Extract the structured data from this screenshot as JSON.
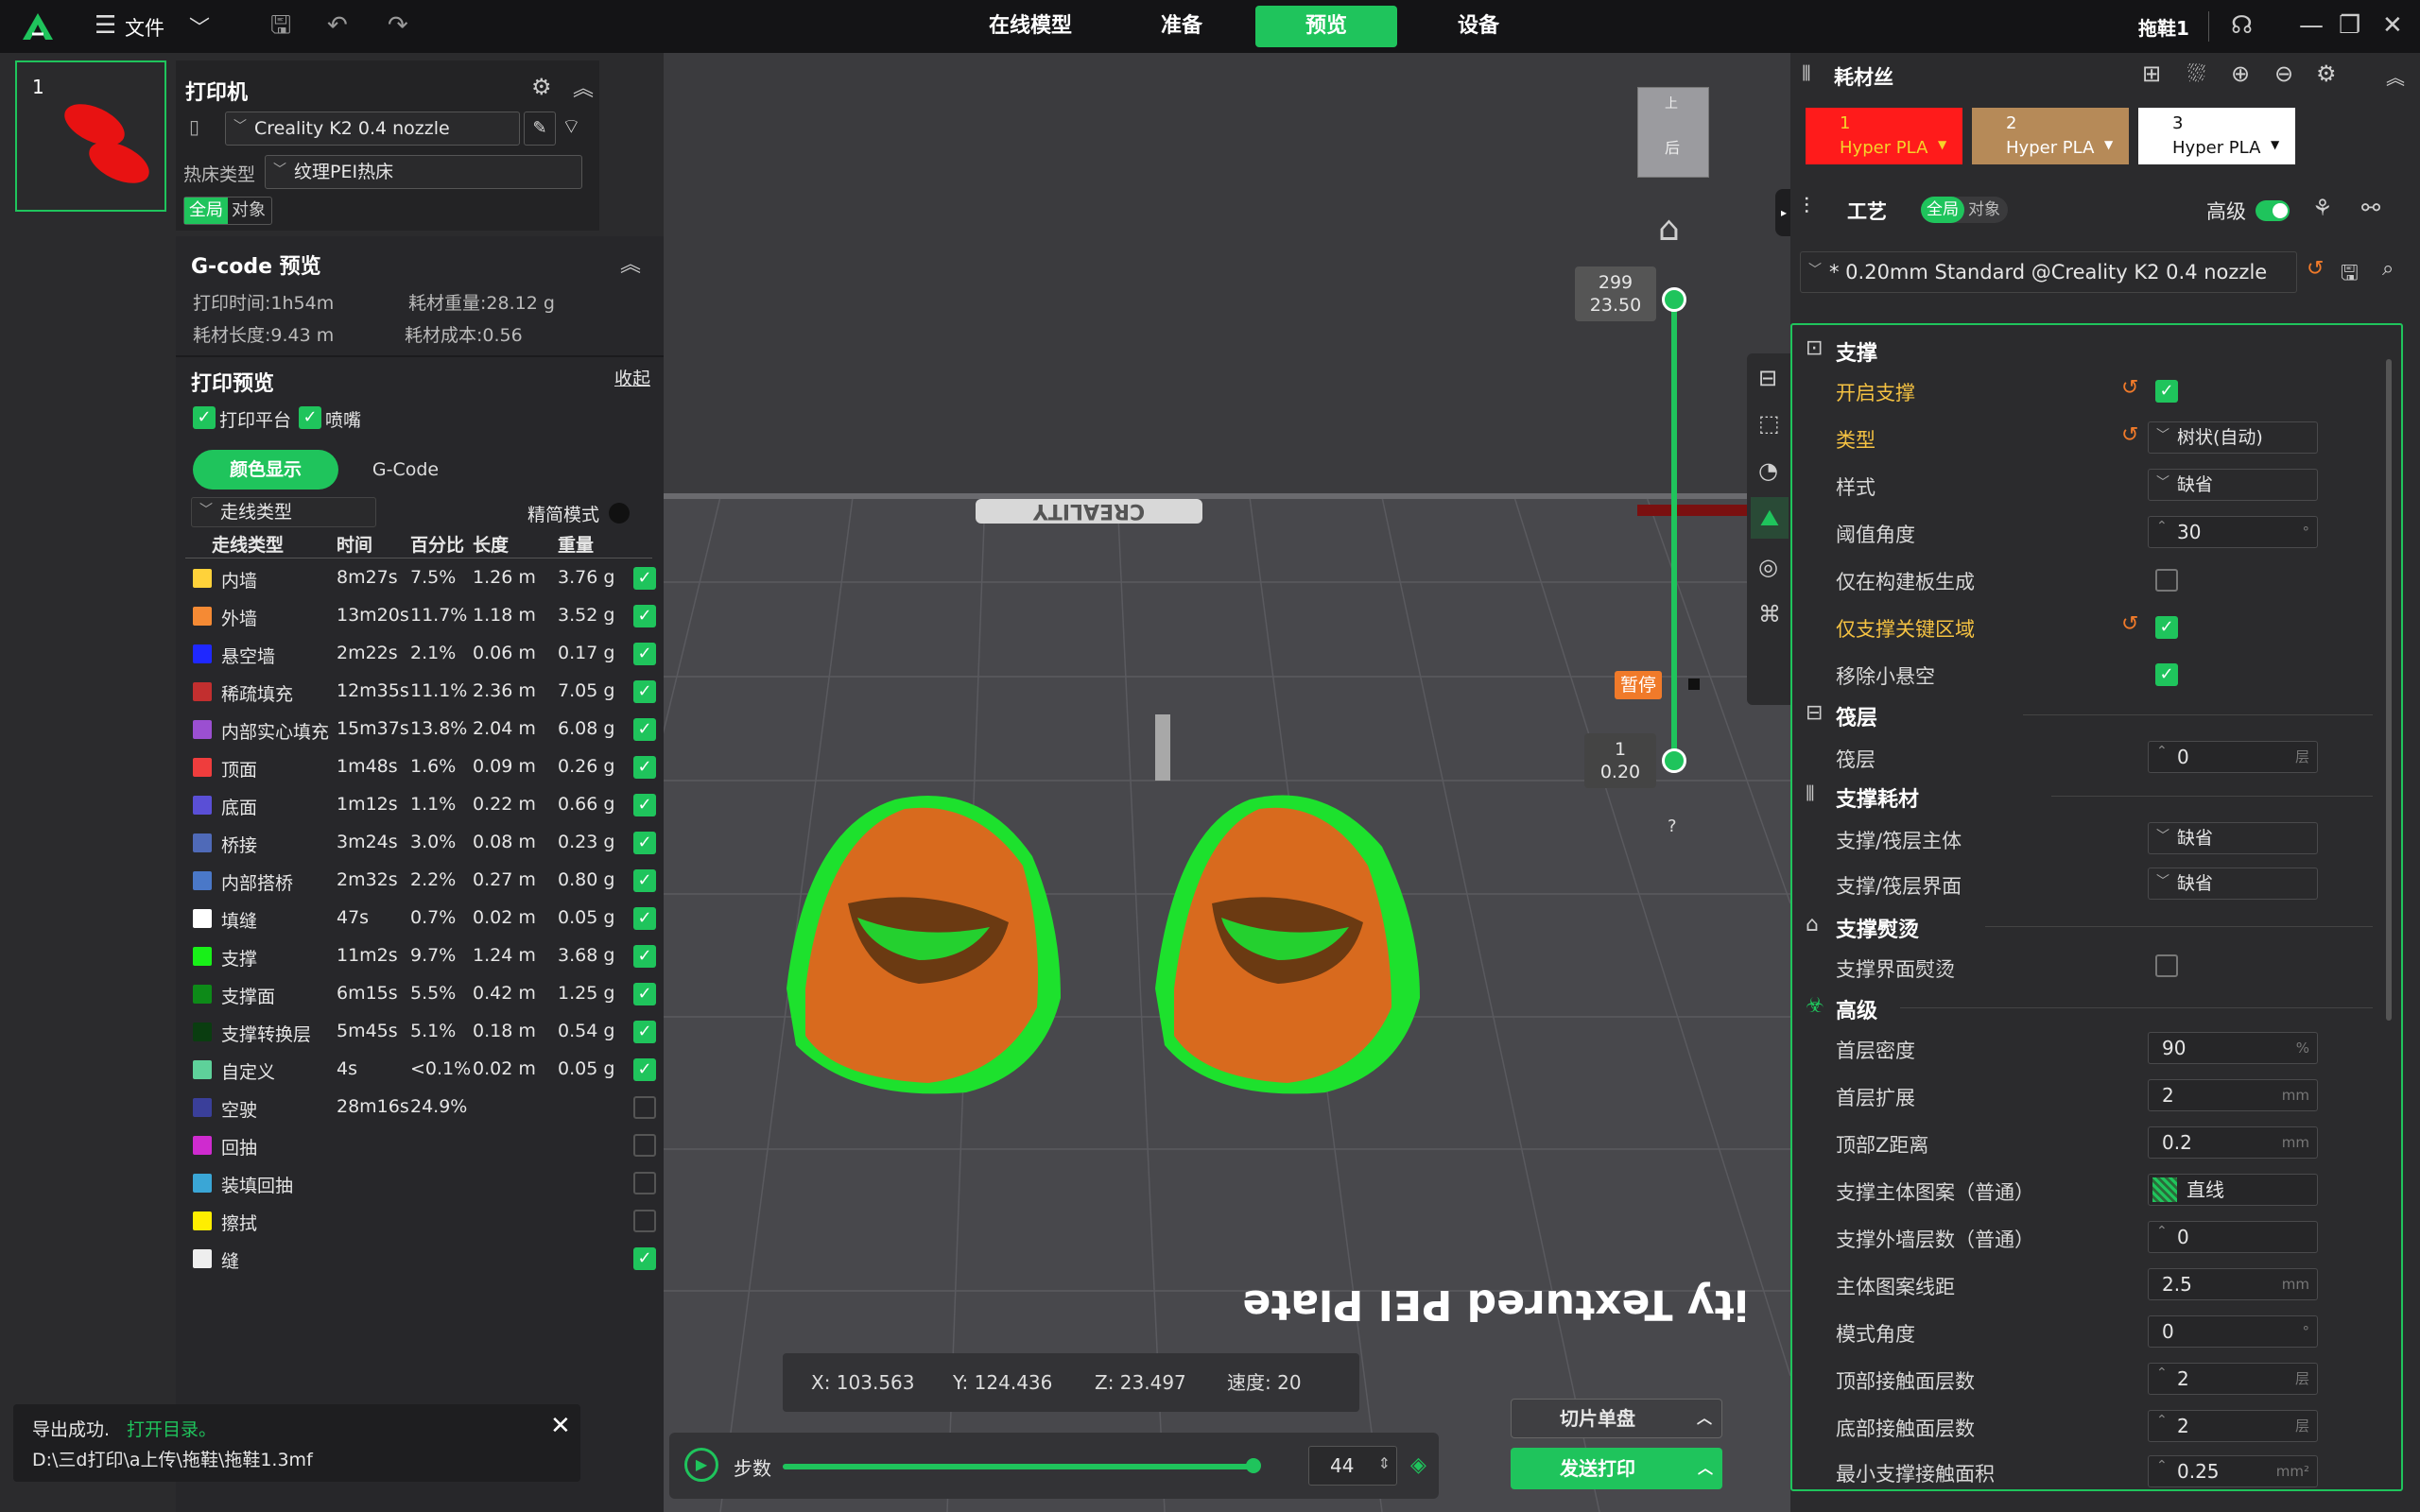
{
  "topbar": {
    "file_menu": "文件",
    "tabs": [
      "在线模型",
      "准备",
      "预览",
      "设备"
    ],
    "active_tab": "预览",
    "project_name": "拖鞋1"
  },
  "colors": {
    "accent": "#1fc45c",
    "filament1": "#ff1b1b",
    "filament2": "#b68a58",
    "filament3": "#ffffff"
  },
  "plate": {
    "number": "1"
  },
  "printer": {
    "title": "打印机",
    "nozzle": "Creality K2 0.4 nozzle",
    "bed_label": "热床类型",
    "bed_value": "纹理PEI热床",
    "scope_global": "全局",
    "scope_object": "对象"
  },
  "gcode": {
    "title": "G-code 预览",
    "print_time": "打印时间:1h54m",
    "filament_weight": "耗材重量:28.12 g",
    "filament_length": "耗材长度:9.43 m",
    "filament_cost": "耗材成本:0.56"
  },
  "preview": {
    "title": "打印预览",
    "collapse": "收起",
    "opt_platform": "打印平台",
    "opt_nozzle": "喷嘴",
    "tab_color": "颜色显示",
    "tab_gcode": "G-Code",
    "line_type_select": "走线类型",
    "mode": "精简模式",
    "headers": [
      "走线类型",
      "时间",
      "百分比",
      "长度",
      "重量"
    ],
    "rows": [
      {
        "color": "#ffd23a",
        "name": "内墙",
        "time": "8m27s",
        "pct": "7.5%",
        "len": "1.26 m",
        "wt": "3.76 g",
        "on": true
      },
      {
        "color": "#f58a34",
        "name": "外墙",
        "time": "13m20s",
        "pct": "11.7%",
        "len": "1.18 m",
        "wt": "3.52 g",
        "on": true
      },
      {
        "color": "#1f28ff",
        "name": "悬空墙",
        "time": "2m22s",
        "pct": "2.1%",
        "len": "0.06 m",
        "wt": "0.17 g",
        "on": true
      },
      {
        "color": "#c22f2f",
        "name": "稀疏填充",
        "time": "12m35s",
        "pct": "11.1%",
        "len": "2.36 m",
        "wt": "7.05 g",
        "on": true
      },
      {
        "color": "#9b4fd1",
        "name": "内部实心填充",
        "time": "15m37s",
        "pct": "13.8%",
        "len": "2.04 m",
        "wt": "6.08 g",
        "on": true
      },
      {
        "color": "#ef3d3d",
        "name": "顶面",
        "time": "1m48s",
        "pct": "1.6%",
        "len": "0.09 m",
        "wt": "0.26 g",
        "on": true
      },
      {
        "color": "#5a4fd6",
        "name": "底面",
        "time": "1m12s",
        "pct": "1.1%",
        "len": "0.22 m",
        "wt": "0.66 g",
        "on": true
      },
      {
        "color": "#4f6ab8",
        "name": "桥接",
        "time": "3m24s",
        "pct": "3.0%",
        "len": "0.08 m",
        "wt": "0.23 g",
        "on": true
      },
      {
        "color": "#4a78c8",
        "name": "内部搭桥",
        "time": "2m32s",
        "pct": "2.2%",
        "len": "0.27 m",
        "wt": "0.80 g",
        "on": true
      },
      {
        "color": "#ffffff",
        "name": "填缝",
        "time": "47s",
        "pct": "0.7%",
        "len": "0.02 m",
        "wt": "0.05 g",
        "on": true
      },
      {
        "color": "#18f018",
        "name": "支撑",
        "time": "11m2s",
        "pct": "9.7%",
        "len": "1.24 m",
        "wt": "3.68 g",
        "on": true
      },
      {
        "color": "#0d8a18",
        "name": "支撑面",
        "time": "6m15s",
        "pct": "5.5%",
        "len": "0.42 m",
        "wt": "1.25 g",
        "on": true
      },
      {
        "color": "#0a3d10",
        "name": "支撑转换层",
        "time": "5m45s",
        "pct": "5.1%",
        "len": "0.18 m",
        "wt": "0.54 g",
        "on": true
      },
      {
        "color": "#5ed19a",
        "name": "自定义",
        "time": "4s",
        "pct": "<0.1%",
        "len": "0.02 m",
        "wt": "0.05 g",
        "on": true
      },
      {
        "color": "#3a3f9a",
        "name": "空驶",
        "time": "28m16s",
        "pct": "24.9%",
        "len": "",
        "wt": "",
        "on": false
      },
      {
        "color": "#cf2bcf",
        "name": "回抽",
        "time": "",
        "pct": "",
        "len": "",
        "wt": "",
        "on": false
      },
      {
        "color": "#3aa6d6",
        "name": "装填回抽",
        "time": "",
        "pct": "",
        "len": "",
        "wt": "",
        "on": false
      },
      {
        "color": "#ffee00",
        "name": "擦拭",
        "time": "",
        "pct": "",
        "len": "",
        "wt": "",
        "on": false
      },
      {
        "color": "#eeeeee",
        "name": "缝",
        "time": "",
        "pct": "",
        "len": "",
        "wt": "",
        "on": true
      }
    ]
  },
  "toast": {
    "msg": "导出成功.",
    "link": "打开目录。",
    "path": "D:\\三d打印\\a上传\\拖鞋\\拖鞋1.3mf"
  },
  "viewport": {
    "cube_top": "上",
    "cube_back": "后",
    "slider_top_layer": "299",
    "slider_top_z": "23.50",
    "slider_bottom_layer": "1",
    "slider_bottom_z": "0.20",
    "pause": "暂停",
    "help": "?",
    "bed_text": "ity Textured PEI Plate",
    "brand": "CREALITY",
    "coords": {
      "x": "X: 103.563",
      "y": "Y: 124.436",
      "z": "Z: 23.497",
      "speed": "速度: 20"
    },
    "steps_label": "步数",
    "steps_value": "44",
    "steps_fraction": 0.995,
    "slice_btn": "切片单盘",
    "send_btn": "发送打印"
  },
  "filament": {
    "title": "耗材丝",
    "slots": [
      {
        "n": "1",
        "name": "Hyper PLA"
      },
      {
        "n": "2",
        "name": "Hyper PLA"
      },
      {
        "n": "3",
        "name": "Hyper PLA"
      }
    ]
  },
  "process": {
    "title": "工艺",
    "global": "全局",
    "object": "对象",
    "advanced": "高级",
    "preset": "* 0.20mm Standard @Creality K2 0.4 nozzle"
  },
  "settings": {
    "sec_support": "支撑",
    "enable_support": "开启支撑",
    "type": "类型",
    "type_val": "树状(自动)",
    "style": "样式",
    "style_val": "缺省",
    "threshold": "阈值角度",
    "threshold_val": "30",
    "threshold_unit": "°",
    "on_build_plate": "仅在构建板生成",
    "critical_only": "仅支撑关键区域",
    "remove_small": "移除小悬空",
    "sec_raft": "筏层",
    "raft": "筏层",
    "raft_val": "0",
    "raft_unit": "层",
    "sec_support_filament": "支撑耗材",
    "base_filament": "支撑/筏层主体",
    "base_filament_val": "缺省",
    "iface_filament": "支撑/筏层界面",
    "iface_filament_val": "缺省",
    "sec_ironing": "支撑熨烫",
    "iface_ironing": "支撑界面熨烫",
    "sec_advanced": "高级",
    "first_density": "首层密度",
    "first_density_val": "90",
    "first_density_unit": "%",
    "first_expand": "首层扩展",
    "first_expand_val": "2",
    "mm": "mm",
    "top_z": "顶部Z距离",
    "top_z_val": "0.2",
    "pattern": "支撑主体图案（普通）",
    "pattern_val": "直线",
    "wall_layers": "支撑外墙层数（普通）",
    "wall_layers_val": "0",
    "line_spacing": "主体图案线距",
    "line_spacing_val": "2.5",
    "pattern_angle": "模式角度",
    "pattern_angle_val": "0",
    "deg": "°",
    "top_iface_layers": "顶部接触面层数",
    "top_iface_val": "2",
    "layer_unit": "层",
    "bottom_iface_layers": "底部接触面层数",
    "bottom_iface_val": "2",
    "min_area": "最小支撑接触面积",
    "min_area_val": "0.25",
    "mm2": "mm²"
  }
}
